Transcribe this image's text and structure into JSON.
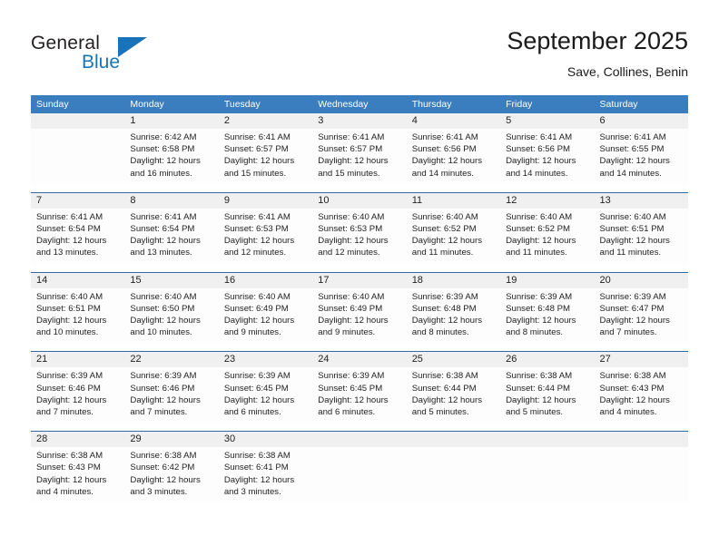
{
  "brand": {
    "name_part1": "General",
    "name_part2": "Blue",
    "triangle_icon": "triangle-icon",
    "color_primary": "#1a72b8",
    "color_text": "#231f20"
  },
  "header": {
    "title": "September 2025",
    "subtitle": "Save, Collines, Benin"
  },
  "theme": {
    "header_row_bg": "#3a7ebf",
    "week_divider": "#2f6ba5",
    "day_band_bg": "#f0f0f0",
    "cell_bg": "#fdfdfd"
  },
  "weekdays": [
    "Sunday",
    "Monday",
    "Tuesday",
    "Wednesday",
    "Thursday",
    "Friday",
    "Saturday"
  ],
  "weeks": [
    {
      "days": [
        {
          "num": "",
          "lines": []
        },
        {
          "num": "1",
          "lines": [
            "Sunrise: 6:42 AM",
            "Sunset: 6:58 PM",
            "Daylight: 12 hours",
            "and 16 minutes."
          ]
        },
        {
          "num": "2",
          "lines": [
            "Sunrise: 6:41 AM",
            "Sunset: 6:57 PM",
            "Daylight: 12 hours",
            "and 15 minutes."
          ]
        },
        {
          "num": "3",
          "lines": [
            "Sunrise: 6:41 AM",
            "Sunset: 6:57 PM",
            "Daylight: 12 hours",
            "and 15 minutes."
          ]
        },
        {
          "num": "4",
          "lines": [
            "Sunrise: 6:41 AM",
            "Sunset: 6:56 PM",
            "Daylight: 12 hours",
            "and 14 minutes."
          ]
        },
        {
          "num": "5",
          "lines": [
            "Sunrise: 6:41 AM",
            "Sunset: 6:56 PM",
            "Daylight: 12 hours",
            "and 14 minutes."
          ]
        },
        {
          "num": "6",
          "lines": [
            "Sunrise: 6:41 AM",
            "Sunset: 6:55 PM",
            "Daylight: 12 hours",
            "and 14 minutes."
          ]
        }
      ]
    },
    {
      "days": [
        {
          "num": "7",
          "lines": [
            "Sunrise: 6:41 AM",
            "Sunset: 6:54 PM",
            "Daylight: 12 hours",
            "and 13 minutes."
          ]
        },
        {
          "num": "8",
          "lines": [
            "Sunrise: 6:41 AM",
            "Sunset: 6:54 PM",
            "Daylight: 12 hours",
            "and 13 minutes."
          ]
        },
        {
          "num": "9",
          "lines": [
            "Sunrise: 6:41 AM",
            "Sunset: 6:53 PM",
            "Daylight: 12 hours",
            "and 12 minutes."
          ]
        },
        {
          "num": "10",
          "lines": [
            "Sunrise: 6:40 AM",
            "Sunset: 6:53 PM",
            "Daylight: 12 hours",
            "and 12 minutes."
          ]
        },
        {
          "num": "11",
          "lines": [
            "Sunrise: 6:40 AM",
            "Sunset: 6:52 PM",
            "Daylight: 12 hours",
            "and 11 minutes."
          ]
        },
        {
          "num": "12",
          "lines": [
            "Sunrise: 6:40 AM",
            "Sunset: 6:52 PM",
            "Daylight: 12 hours",
            "and 11 minutes."
          ]
        },
        {
          "num": "13",
          "lines": [
            "Sunrise: 6:40 AM",
            "Sunset: 6:51 PM",
            "Daylight: 12 hours",
            "and 11 minutes."
          ]
        }
      ]
    },
    {
      "days": [
        {
          "num": "14",
          "lines": [
            "Sunrise: 6:40 AM",
            "Sunset: 6:51 PM",
            "Daylight: 12 hours",
            "and 10 minutes."
          ]
        },
        {
          "num": "15",
          "lines": [
            "Sunrise: 6:40 AM",
            "Sunset: 6:50 PM",
            "Daylight: 12 hours",
            "and 10 minutes."
          ]
        },
        {
          "num": "16",
          "lines": [
            "Sunrise: 6:40 AM",
            "Sunset: 6:49 PM",
            "Daylight: 12 hours",
            "and 9 minutes."
          ]
        },
        {
          "num": "17",
          "lines": [
            "Sunrise: 6:40 AM",
            "Sunset: 6:49 PM",
            "Daylight: 12 hours",
            "and 9 minutes."
          ]
        },
        {
          "num": "18",
          "lines": [
            "Sunrise: 6:39 AM",
            "Sunset: 6:48 PM",
            "Daylight: 12 hours",
            "and 8 minutes."
          ]
        },
        {
          "num": "19",
          "lines": [
            "Sunrise: 6:39 AM",
            "Sunset: 6:48 PM",
            "Daylight: 12 hours",
            "and 8 minutes."
          ]
        },
        {
          "num": "20",
          "lines": [
            "Sunrise: 6:39 AM",
            "Sunset: 6:47 PM",
            "Daylight: 12 hours",
            "and 7 minutes."
          ]
        }
      ]
    },
    {
      "days": [
        {
          "num": "21",
          "lines": [
            "Sunrise: 6:39 AM",
            "Sunset: 6:46 PM",
            "Daylight: 12 hours",
            "and 7 minutes."
          ]
        },
        {
          "num": "22",
          "lines": [
            "Sunrise: 6:39 AM",
            "Sunset: 6:46 PM",
            "Daylight: 12 hours",
            "and 7 minutes."
          ]
        },
        {
          "num": "23",
          "lines": [
            "Sunrise: 6:39 AM",
            "Sunset: 6:45 PM",
            "Daylight: 12 hours",
            "and 6 minutes."
          ]
        },
        {
          "num": "24",
          "lines": [
            "Sunrise: 6:39 AM",
            "Sunset: 6:45 PM",
            "Daylight: 12 hours",
            "and 6 minutes."
          ]
        },
        {
          "num": "25",
          "lines": [
            "Sunrise: 6:38 AM",
            "Sunset: 6:44 PM",
            "Daylight: 12 hours",
            "and 5 minutes."
          ]
        },
        {
          "num": "26",
          "lines": [
            "Sunrise: 6:38 AM",
            "Sunset: 6:44 PM",
            "Daylight: 12 hours",
            "and 5 minutes."
          ]
        },
        {
          "num": "27",
          "lines": [
            "Sunrise: 6:38 AM",
            "Sunset: 6:43 PM",
            "Daylight: 12 hours",
            "and 4 minutes."
          ]
        }
      ]
    },
    {
      "days": [
        {
          "num": "28",
          "lines": [
            "Sunrise: 6:38 AM",
            "Sunset: 6:43 PM",
            "Daylight: 12 hours",
            "and 4 minutes."
          ]
        },
        {
          "num": "29",
          "lines": [
            "Sunrise: 6:38 AM",
            "Sunset: 6:42 PM",
            "Daylight: 12 hours",
            "and 3 minutes."
          ]
        },
        {
          "num": "30",
          "lines": [
            "Sunrise: 6:38 AM",
            "Sunset: 6:41 PM",
            "Daylight: 12 hours",
            "and 3 minutes."
          ]
        },
        {
          "num": "",
          "lines": []
        },
        {
          "num": "",
          "lines": []
        },
        {
          "num": "",
          "lines": []
        },
        {
          "num": "",
          "lines": []
        }
      ]
    }
  ]
}
